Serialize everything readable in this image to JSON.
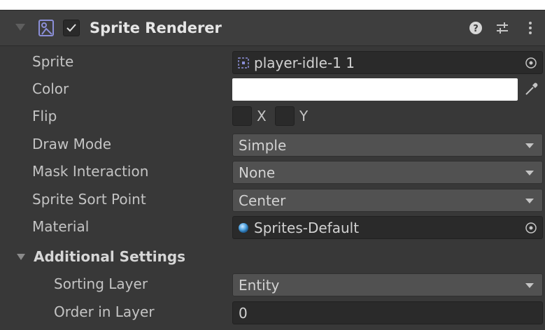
{
  "component": {
    "title": "Sprite Renderer",
    "enabled": true,
    "icons": [
      "sprite-renderer-icon",
      "help-icon",
      "preset-sliders-icon",
      "more-vert-icon"
    ]
  },
  "properties": {
    "sprite": {
      "label": "Sprite",
      "value": "player-idle-1 1"
    },
    "color": {
      "label": "Color",
      "value": "#ffffff"
    },
    "flip": {
      "label": "Flip",
      "x_label": "X",
      "y_label": "Y",
      "x_checked": false,
      "y_checked": false
    },
    "draw_mode": {
      "label": "Draw Mode",
      "value": "Simple"
    },
    "mask_interaction": {
      "label": "Mask Interaction",
      "value": "None"
    },
    "sprite_sort_point": {
      "label": "Sprite Sort Point",
      "value": "Center"
    },
    "material": {
      "label": "Material",
      "value": "Sprites-Default"
    }
  },
  "additional_settings": {
    "label": "Additional Settings",
    "sorting_layer": {
      "label": "Sorting Layer",
      "value": "Entity"
    },
    "order_in_layer": {
      "label": "Order in Layer",
      "value": "0"
    }
  },
  "colors": {
    "panel_bg": "#383838",
    "header_bg": "#3e3e3e",
    "field_bg": "#2a2a2a",
    "dropdown_bg": "#515151",
    "text": "#c4c4c4",
    "accent_blue": "#4fa3e0"
  }
}
